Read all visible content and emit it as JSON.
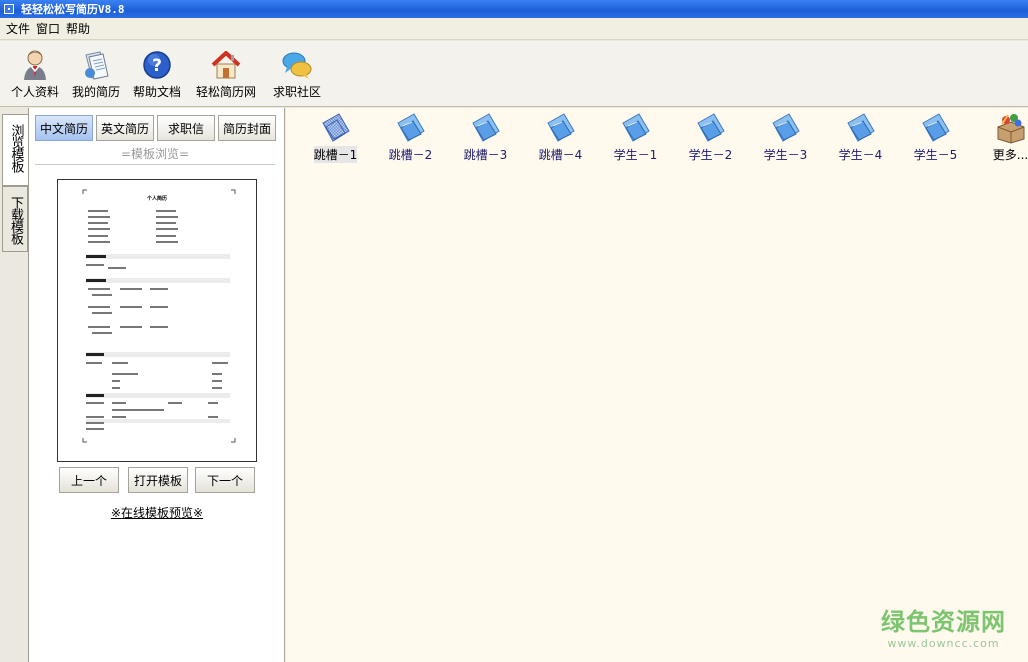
{
  "window": {
    "title": "轻轻松松写简历V8.8"
  },
  "menu": [
    "文件",
    "窗口",
    "帮助"
  ],
  "toolbar": {
    "buttons": [
      {
        "label": "个人资料",
        "icon": "person-icon"
      },
      {
        "label": "我的简历",
        "icon": "document-icon"
      },
      {
        "label": "帮助文档",
        "icon": "help-icon"
      },
      {
        "label": "轻松简历网",
        "icon": "home-icon"
      },
      {
        "label": "求职社区",
        "icon": "chat-bubbles-icon"
      }
    ]
  },
  "side_tabs": [
    {
      "label": "浏览模板",
      "active": true
    },
    {
      "label": "下载模板",
      "active": false
    }
  ],
  "left_panel": {
    "tabs": [
      "中文简历",
      "英文简历",
      "求职信",
      "简历封面"
    ],
    "active_tab": "中文简历",
    "section_label": "=模板浏览=",
    "preview_heading": "个人简历",
    "buttons": {
      "prev": "上一个",
      "open": "打开模板",
      "next": "下一个"
    },
    "online_link": "※在线模板预览※"
  },
  "templates": [
    {
      "label": "跳槽－1",
      "selected": true,
      "icon": "template-doc-icon"
    },
    {
      "label": "跳槽－2",
      "selected": false,
      "icon": "folder-doc-icon"
    },
    {
      "label": "跳槽－3",
      "selected": false,
      "icon": "folder-doc-icon"
    },
    {
      "label": "跳槽－4",
      "selected": false,
      "icon": "folder-doc-icon"
    },
    {
      "label": "学生－1",
      "selected": false,
      "icon": "folder-doc-icon"
    },
    {
      "label": "学生－2",
      "selected": false,
      "icon": "folder-doc-icon"
    },
    {
      "label": "学生－3",
      "selected": false,
      "icon": "folder-doc-icon"
    },
    {
      "label": "学生－4",
      "selected": false,
      "icon": "folder-doc-icon"
    },
    {
      "label": "学生－5",
      "selected": false,
      "icon": "folder-doc-icon"
    },
    {
      "label": "更多...",
      "selected": false,
      "icon": "more-box-icon"
    }
  ],
  "watermark": {
    "line1": "绿色资源网",
    "line2": "www.downcc.com"
  },
  "colors": {
    "title_bar": "#1c5fd6",
    "main_bg": "#fff9ee",
    "tab_active": "#a6c3ef",
    "template_label": "#1c1c6e"
  }
}
